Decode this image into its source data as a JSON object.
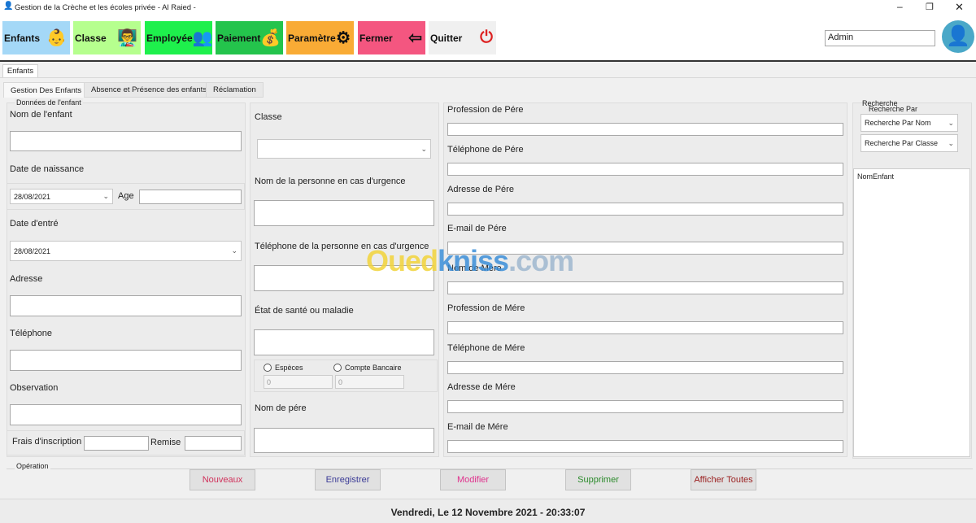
{
  "window": {
    "title": "Gestion de la Crèche et les écoles privée - Al Raied -"
  },
  "toolbar": [
    {
      "label": "Enfants",
      "color": "#a4d8f7",
      "icon": "baby-icon",
      "glyph": "👶"
    },
    {
      "label": "Classe",
      "color": "#b6ff8e",
      "icon": "teacher-class-icon",
      "glyph": "👨‍🏫"
    },
    {
      "label": "Employée",
      "color": "#1ef04c",
      "icon": "employees-icon",
      "glyph": "👥"
    },
    {
      "label": "Paiement",
      "color": "#24c44c",
      "icon": "money-bag-icon",
      "glyph": "💰"
    },
    {
      "label": "Paramètre",
      "color": "#f9ab35",
      "icon": "gear-icon",
      "glyph": "⚙"
    },
    {
      "label": "Fermer",
      "color": "#f45680",
      "icon": "logout-icon",
      "glyph": "⇦"
    },
    {
      "label": "Quitter",
      "color": "#f0f0f0",
      "icon": "power-icon",
      "glyph": "⏻"
    }
  ],
  "user": {
    "name": "Admin",
    "avatar_color": "#4aa8c8"
  },
  "main_tab": "Enfants",
  "tabs": [
    "Gestion Des Enfants",
    "Absence et Présence des enfants",
    "Réclamation"
  ],
  "left": {
    "group": "Données de l'enfant",
    "nom": "Nom de l'enfant",
    "naissance": "Date de naissance",
    "naissance_value": "28/08/2021",
    "age": "Age",
    "entre": "Date d'entré",
    "entre_value": "28/08/2021",
    "adresse": "Adresse",
    "telephone": "Téléphone",
    "observation": "Observation",
    "frais": "Frais d'inscription",
    "remise": "Remise"
  },
  "middle": {
    "classe": "Classe",
    "urgence_nom": "Nom de la personne en cas d'urgence",
    "urgence_tel": "Téléphone de la personne en cas d'urgence",
    "sante": "État de santé ou maladie",
    "especes": "Espèces",
    "compte": "Compte Bancaire",
    "especes_value": "0",
    "compte_value": "0",
    "nom_pere": "Nom de pére"
  },
  "right": {
    "fields": [
      "Profession de Pére",
      "Téléphone de Pére",
      "Adresse de Pére",
      "E-mail de Pére",
      "Nom de Mére",
      "Profession de Mére",
      "Téléphone de Mére",
      "Adresse de Mére",
      "E-mail de Mére"
    ]
  },
  "search": {
    "group": "Recherche",
    "sub": "Recherche Par",
    "by_name": "Recherche Par Nom",
    "by_class": "Recherche Par Classe",
    "list_header": "NomEnfant"
  },
  "operation": {
    "label": "Opération",
    "buttons": [
      {
        "label": "Nouveaux",
        "color": "#d0305a"
      },
      {
        "label": "Enregistrer",
        "color": "#3a3a96"
      },
      {
        "label": "Modifier",
        "color": "#e0308c"
      },
      {
        "label": "Supprimer",
        "color": "#2a8a2a"
      },
      {
        "label": "Afficher Toutes",
        "color": "#9a1f1f"
      }
    ]
  },
  "status": "Vendredi, Le 12 Novembre 2021 - 20:33:07",
  "watermark": "Ouedkniss.com"
}
